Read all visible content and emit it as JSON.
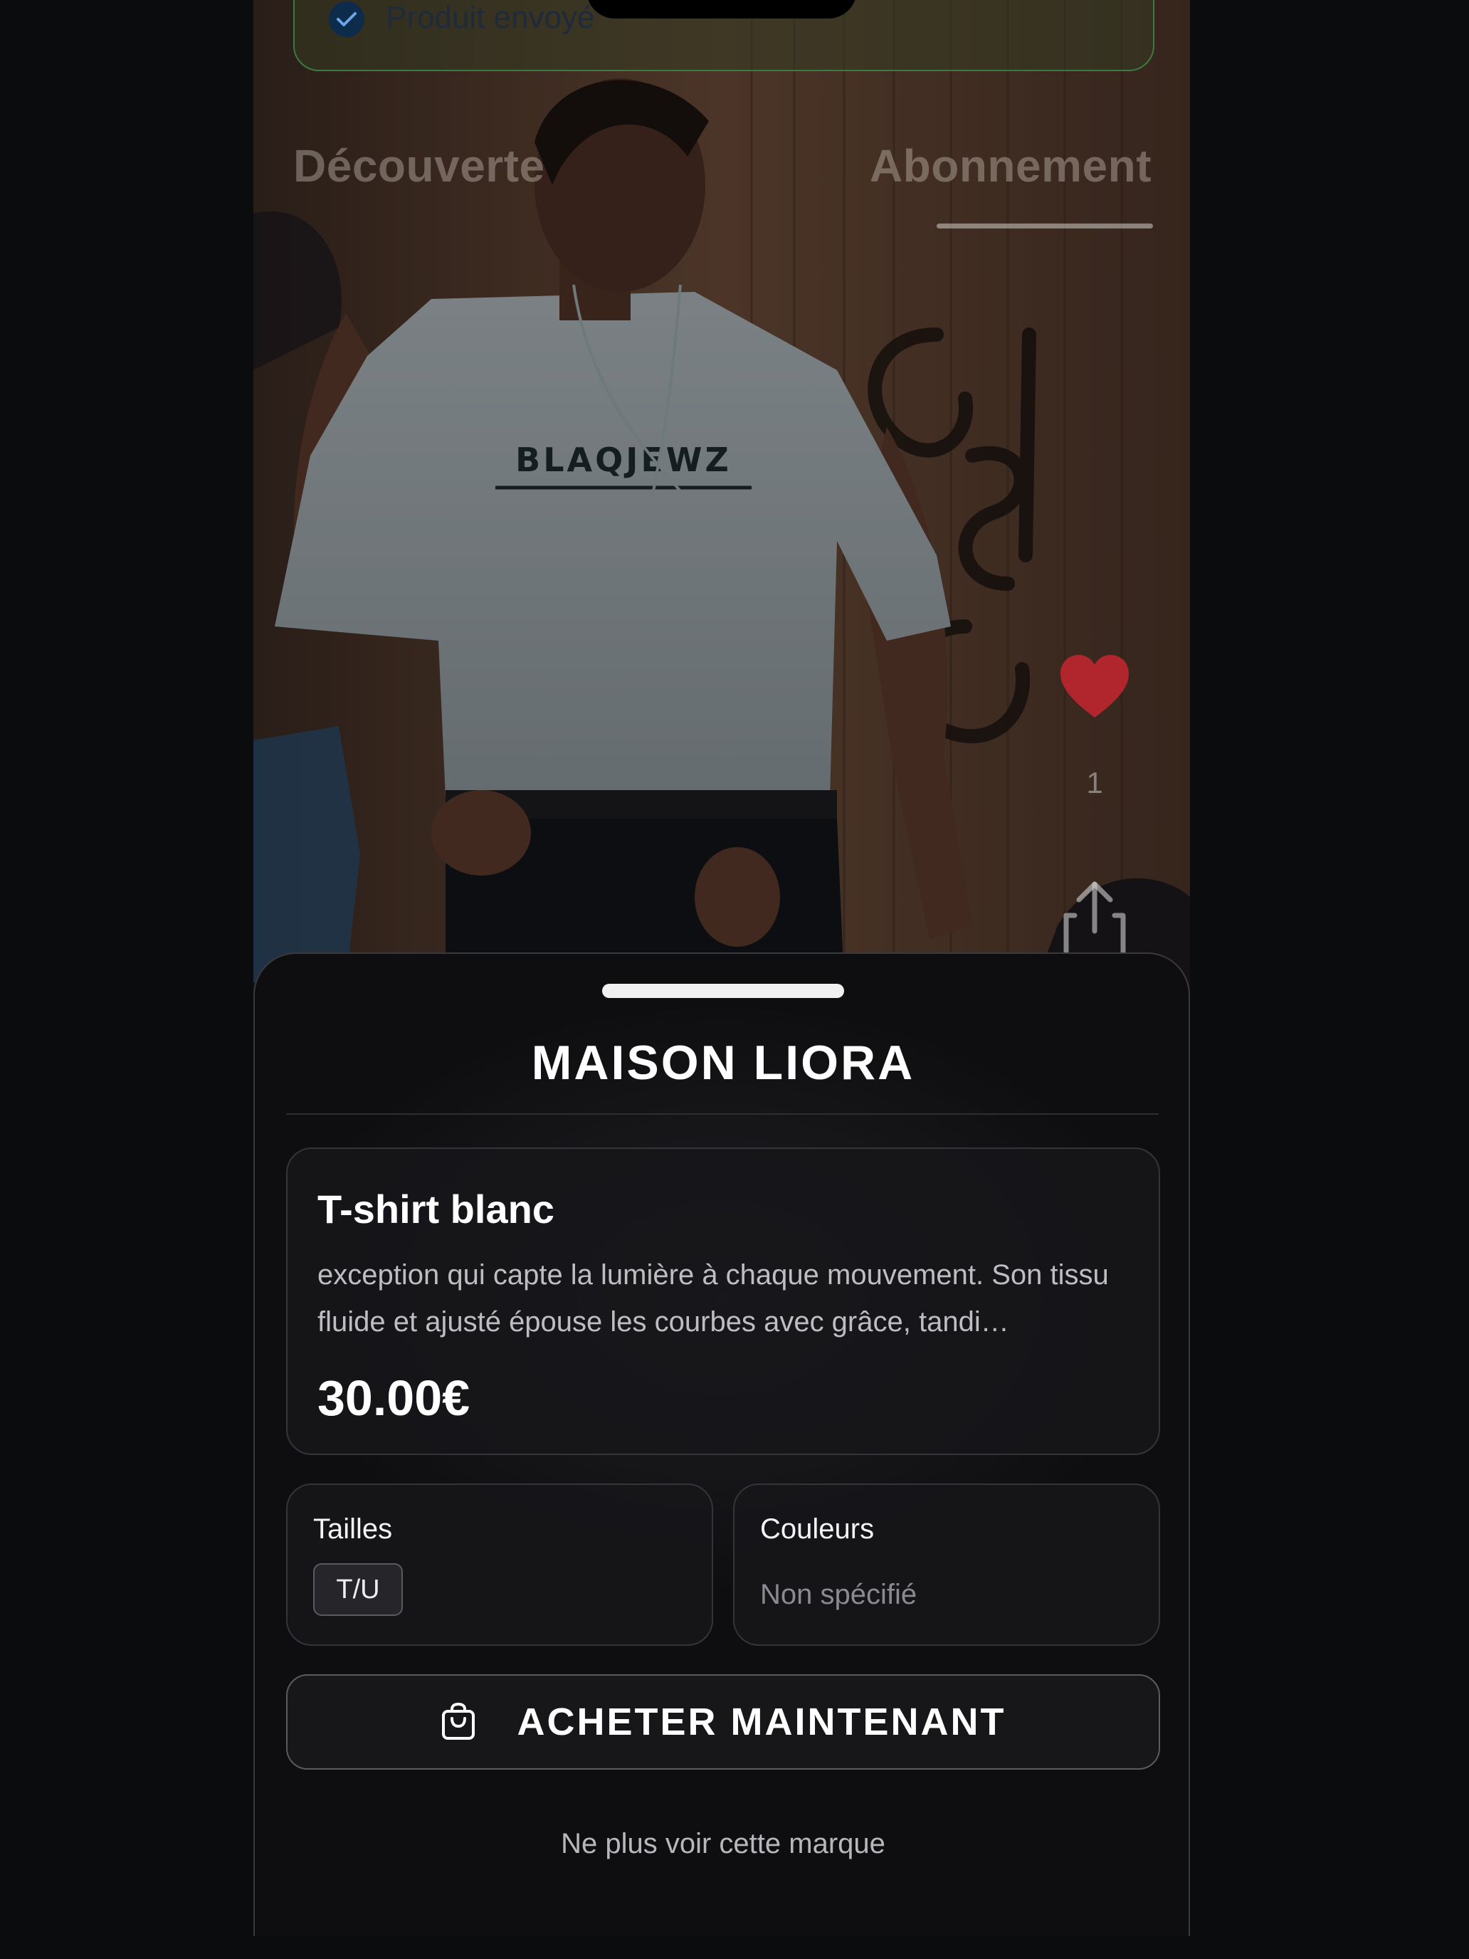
{
  "toast": {
    "text": "Produit envoyé",
    "icon": "check-circle-icon"
  },
  "tabs": {
    "discover": "Découverte",
    "subscription": "Abonnement",
    "active": "Abonnement"
  },
  "actions": {
    "like_count": "1",
    "like_icon": "heart-icon",
    "share_icon": "share-icon"
  },
  "sheet": {
    "brand": "MAISON LIORA",
    "product": {
      "title": "T-shirt blanc",
      "description": "exception qui capte la lumière à chaque mouvement. Son tissu fluide et ajusté épouse les courbes avec grâce, tandi…",
      "price": "30.00€"
    },
    "sizes": {
      "label": "Tailles",
      "selected": "T/U"
    },
    "colors": {
      "label": "Couleurs",
      "value": "Non spécifié"
    },
    "buy_button": {
      "label": "ACHETER MAINTENANT",
      "icon": "shopping-bag-icon"
    },
    "hide_brand_link": "Ne plus voir cette marque"
  },
  "colors": {
    "accent_green": "#3e7a3c",
    "like_red": "#b0262c",
    "sheet_bg": "#0e0e10"
  }
}
